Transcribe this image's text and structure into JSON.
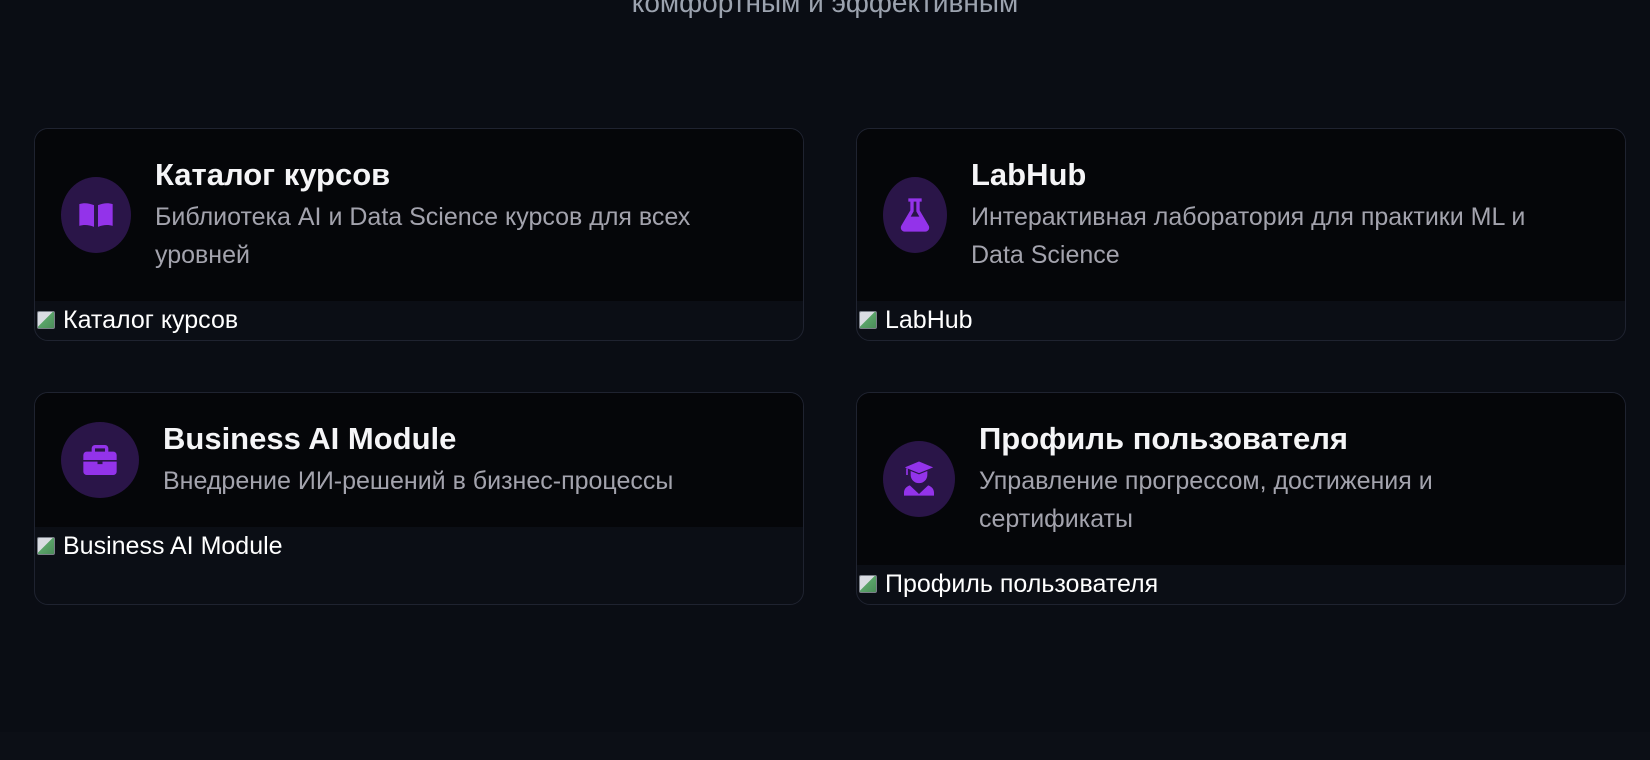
{
  "header": {
    "subtitle": "комфортным и эффективным"
  },
  "cards": [
    {
      "title": "Каталог курсов",
      "description": "Библиотека AI и Data Science курсов для всех уровней",
      "icon": "book-open-icon",
      "image_alt": "Каталог курсов"
    },
    {
      "title": "LabHub",
      "description": "Интерактивная лаборатория для практики ML и Data Science",
      "icon": "flask-icon",
      "image_alt": "LabHub"
    },
    {
      "title": "Business AI Module",
      "description": "Внедрение ИИ-решений в бизнес-процессы",
      "icon": "briefcase-icon",
      "image_alt": "Business AI Module"
    },
    {
      "title": "Профиль пользователя",
      "description": "Управление прогрессом, достижения и сертификаты",
      "icon": "graduate-user-icon",
      "image_alt": "Профиль пользователя"
    }
  ],
  "colors": {
    "background": "#0a0d14",
    "card_header": "#050609",
    "accent_purple": "#9333ea",
    "icon_bg": "#2a1548"
  }
}
